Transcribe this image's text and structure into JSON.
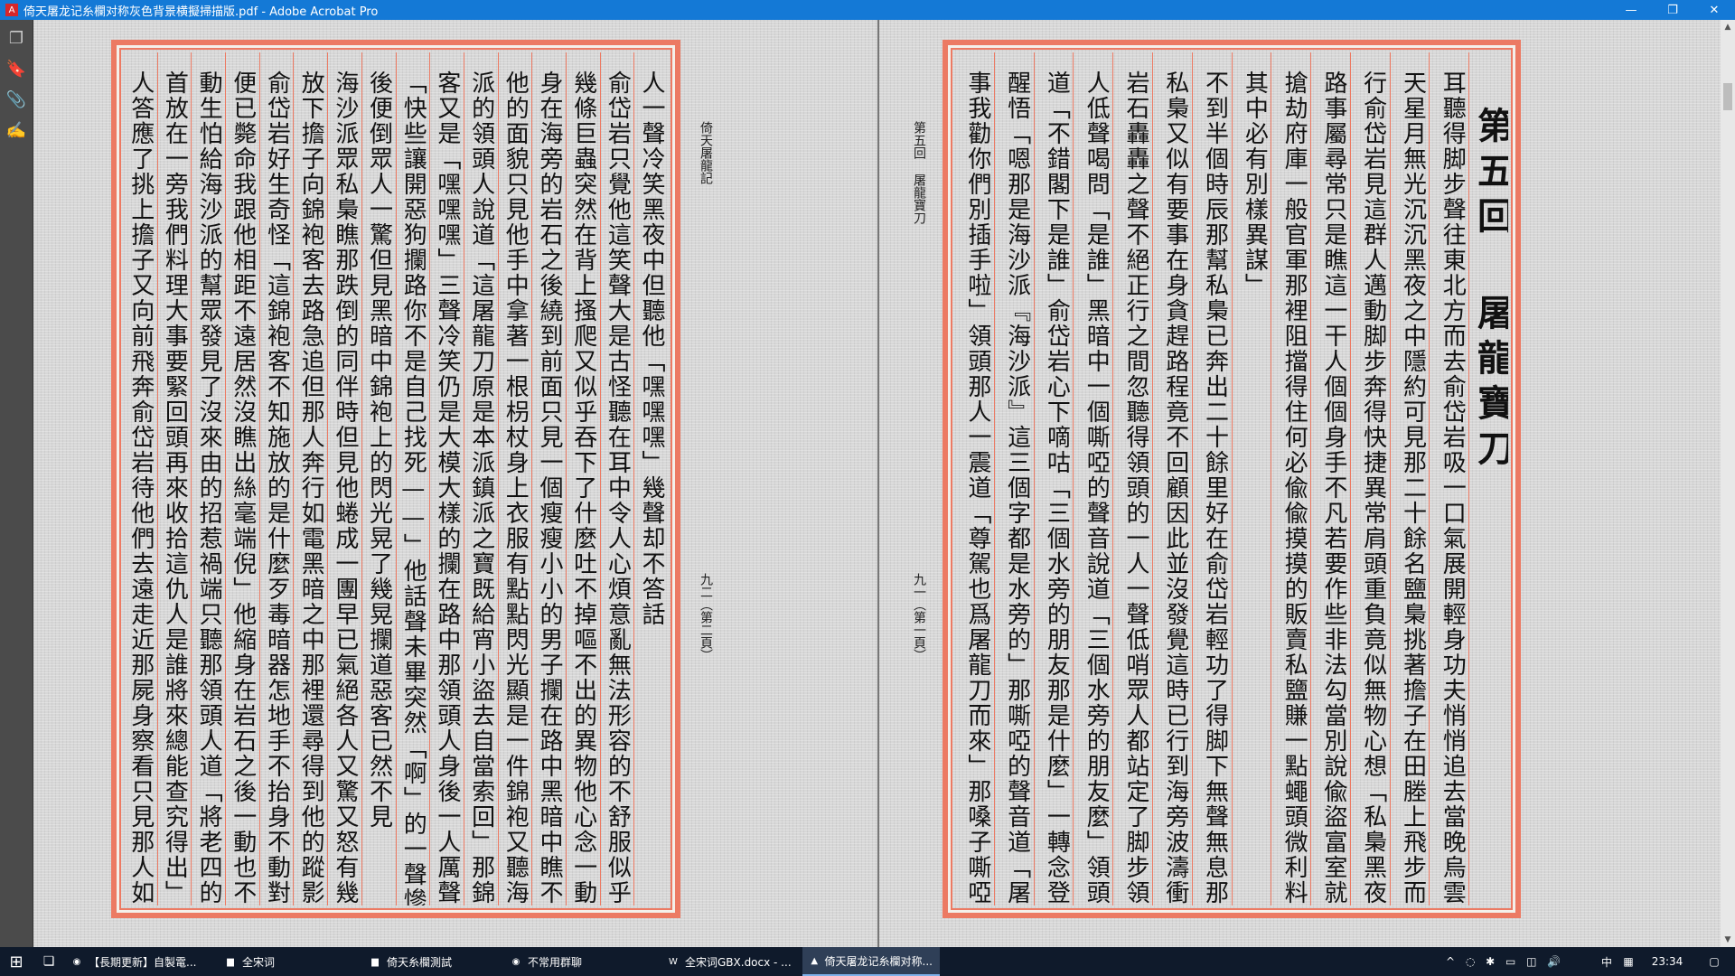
{
  "window": {
    "title": "倚天屠龙记糸欄对称灰色背景横擬掃描版.pdf - Adobe Acrobat Pro",
    "min": "—",
    "max": "❐",
    "close": "✕"
  },
  "nav_icons": {
    "pages": "❐",
    "bookmarks": "🔖",
    "attachments": "📎",
    "signatures": "✍"
  },
  "left_page": {
    "header": "倚天屠龍記",
    "footer": "九二（第二頁）",
    "columns": [
      "人一聲冷笑黑夜中但聽他「嘿嘿嘿」幾聲却不答話",
      "俞岱岩只覺他這笑聲大是古怪聽在耳中令人心煩意亂無法形容的不舒服似乎十",
      "幾條巨蟲突然在背上搔爬又似乎吞下了什麼吐不掉嘔不出的異物他心念一動隱",
      "身在海旁的岩石之後繞到前面只見一個瘦瘦小小的男子攔在路中黑暗中瞧不清",
      "他的面貌只見他手中拿著一根枴杖身上衣服有點點閃光顯是一件錦袍又聽海沙",
      "派的領頭人說道「這屠龍刀原是本派鎮派之寶既給宵小盜去自當索回」那錦袍",
      "客又是「嘿嘿嘿」三聲冷笑仍是大模大樣的攔在路中那領頭人身後一人厲聲喝道",
      "「快些讓開惡狗攔路你不是自己找死——」他話聲未畢突然「啊」的一聲慘叫往",
      "後便倒眾人一驚但見黑暗中錦袍上的閃光晃了幾晃攔道惡客已然不見",
      "海沙派眾私梟瞧那跌倒的同伴時但見他蜷成一團早已氣絕各人又驚又怒有幾人",
      "放下擔子向錦袍客去路急追但那人奔行如電黑暗之中那裡還尋得到他的蹤影",
      "俞岱岩好生奇怪「這錦袍客不知施放的是什麼歹毒暗器怎地手不抬身不動對方",
      "便已斃命我跟他相距不遠居然沒瞧出絲毫端倪」他縮身在岩石之後一動也不敢",
      "動生怕給海沙派的幫眾發見了沒來由的招惹禍端只聽那領頭人道「將老四的屍",
      "首放在一旁我們料理大事要緊回頭再來收拾這仇人是誰將來總能查究得出」眾",
      "人答應了挑上擔子又向前飛奔俞岱岩待他們去遠走近那屍身察看只見那人如死"
    ]
  },
  "right_page": {
    "header": "第五回 屠龍寶刀",
    "footer": "九一（第一頁）",
    "heading": "第五回 屠龍寶刀",
    "columns": [
      "耳聽得脚步聲往東北方而去俞岱岩吸一口氣展開輕身功夫悄悄追去當晚烏雲滿",
      "天星月無光沉沉黑夜之中隱約可見那二十餘名鹽梟挑著擔子在田塍上飛步而",
      "行俞岱岩見這群人邁動脚步奔得快捷異常肩頭重負竟似無物心想「私梟黑夜趕",
      "路事屬尋常只是瞧這一干人個個身手不凡若要作些非法勾當別說偸盜富室就是",
      "搶劫府庫一般官軍那裡阻擋得住何必偸偸摸摸的販賣私鹽賺一點蠅頭微利料來",
      "其中必有別樣異謀」",
      "不到半個時辰那幫私梟已奔出二十餘里好在俞岱岩輕功了得脚下無聲無息那幫",
      "私梟又似有要事在身貪趕路程竟不回顧因此並沒發覺這時已行到海旁波濤衝擊",
      "岩石轟轟之聲不絕正行之間忽聽得領頭的一人一聲低哨眾人都站定了脚步領頭",
      "人低聲喝問「是誰」黑暗中一個嘶啞的聲音說道「三個水旁的朋友麼」領頭那人",
      "道「不錯閣下是誰」俞岱岩心下嘀咕「三個水旁的朋友那是什麼」一轉念登時",
      "醒悟「嗯那是海沙派『海沙派』這三個字都是水旁的」那嘶啞的聲音道「屠龍刀的",
      "事我勸你們別插手啦」領頭那人一震道「尊駕也爲屠龍刀而來」那嗓子嘶啞的"
    ]
  },
  "scrollbar": {
    "up": "▲",
    "down": "▼"
  },
  "taskbar": {
    "start": "⊞",
    "taskview": "❏",
    "tasks": [
      {
        "icon": "◉",
        "label": "【長期更新】自製電..."
      },
      {
        "icon": "▆",
        "label": "全宋词"
      },
      {
        "icon": "▆",
        "label": "倚天糸欄測試"
      },
      {
        "icon": "◉",
        "label": "不常用群聊"
      },
      {
        "icon": "W",
        "label": "全宋词GBX.docx - ..."
      },
      {
        "icon": "▲",
        "label": "倚天屠龙记糸欄对称..."
      }
    ],
    "tray_icons": "^ ◌ ✱ ▭ ◫ 🔊",
    "ime": "中",
    "keyboard": "▦",
    "clock": "23:34",
    "notify": "▢"
  },
  "colors": {
    "frame": "#ec7a63",
    "titlebar": "#1479d6",
    "taskbar": "#0f1a2b"
  }
}
